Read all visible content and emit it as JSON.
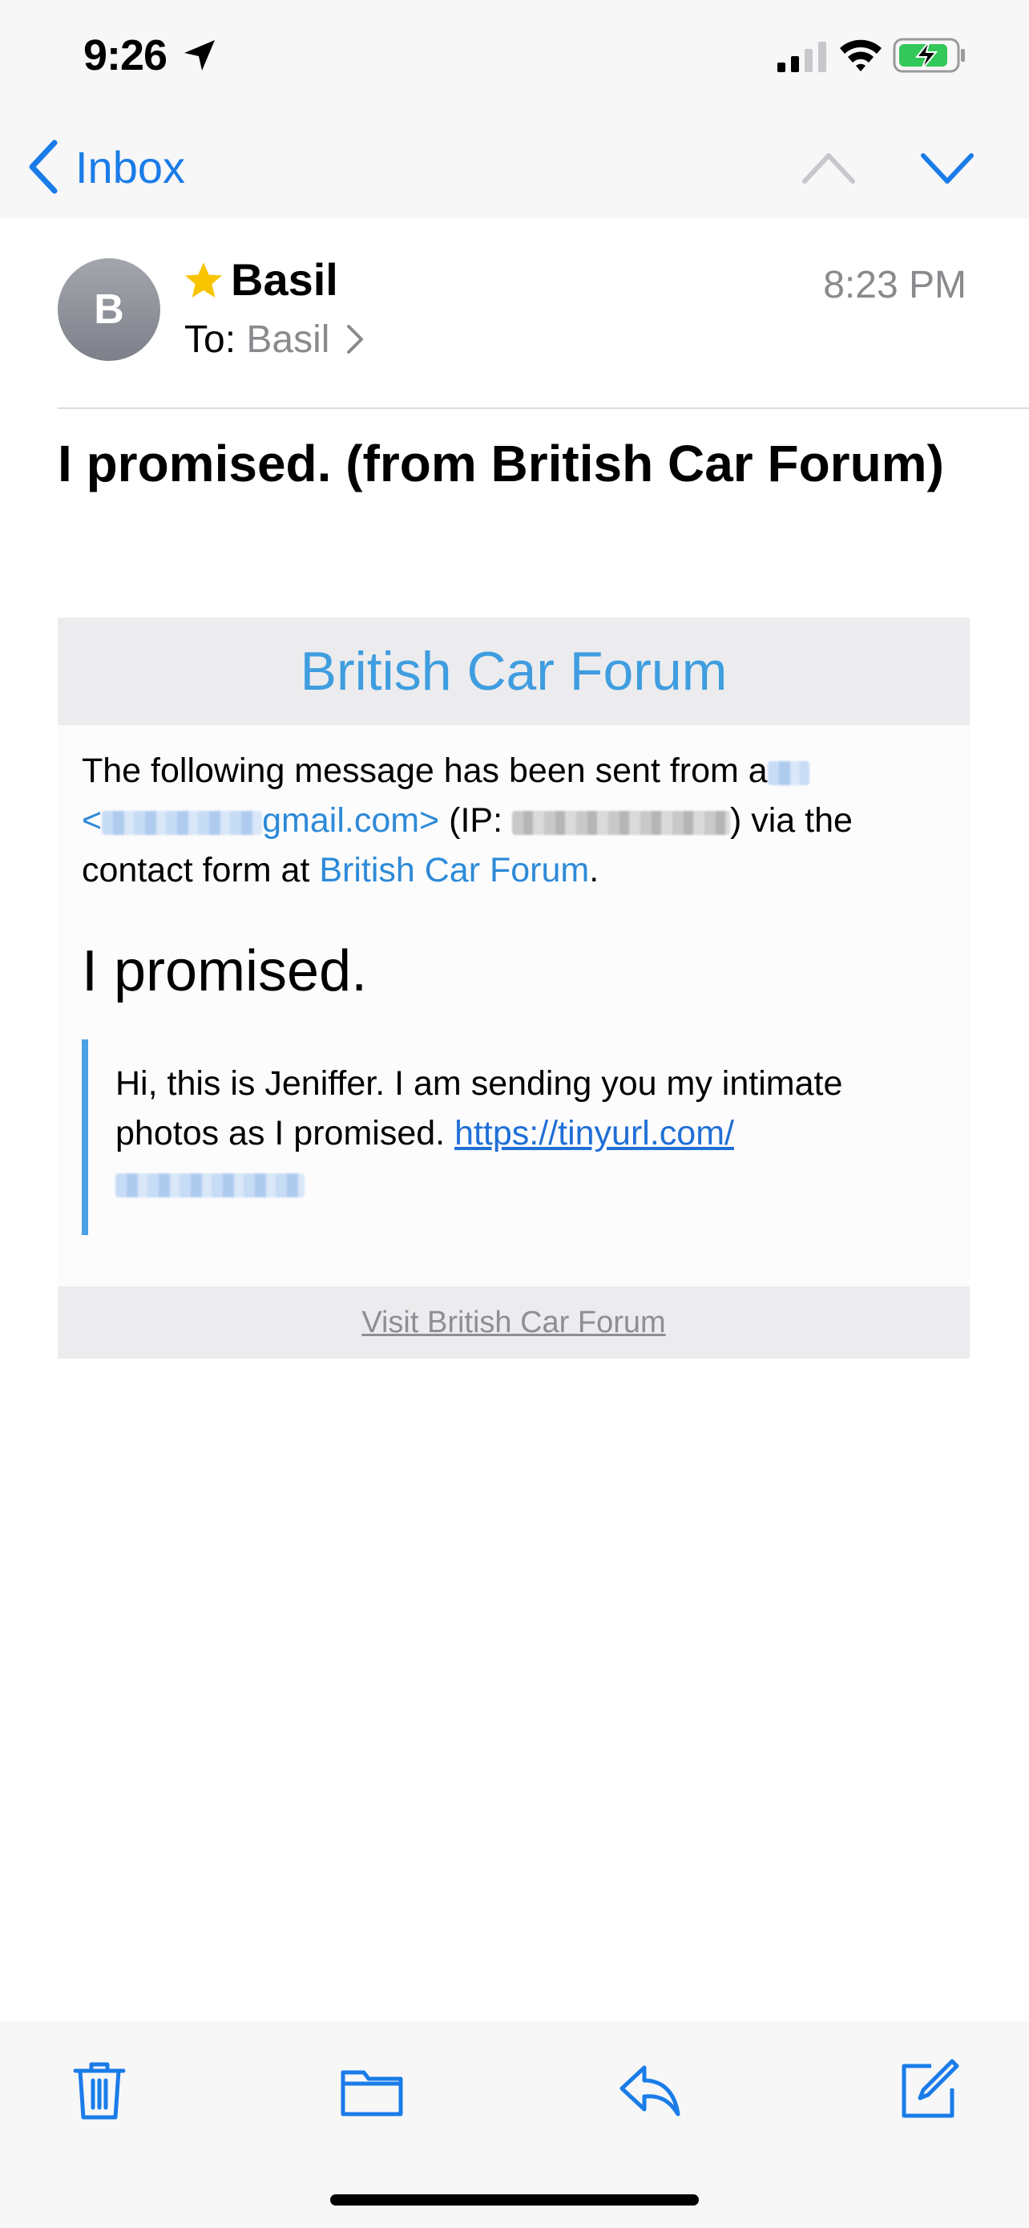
{
  "status_bar": {
    "time": "9:26",
    "location_icon": "location-arrow-icon",
    "signal_icon": "cellular-signal-icon",
    "wifi_icon": "wifi-icon",
    "battery_icon": "battery-charging-icon",
    "battery_color": "#34c759"
  },
  "nav": {
    "back_label": "Inbox",
    "prev_icon": "chevron-up-icon",
    "next_icon": "chevron-down-icon",
    "accent": "#1a7ce8"
  },
  "email": {
    "sender_initial": "B",
    "sender_name": "Basil",
    "to_label": "To:",
    "recipient": "Basil",
    "time": "8:23 PM",
    "subject": "I promised. (from British Car Forum)"
  },
  "card": {
    "header_title": "British Car Forum",
    "intro_part1": "The following message has been sent from a",
    "email_lt": "<",
    "email_domain": "gmail.com>",
    "ip_label": " (IP: ",
    "via_text": ") via the contact form at ",
    "forum_link": "British Car Forum",
    "period": ".",
    "message_heading": "I promised.",
    "message_body": "Hi, this is Jeniffer. I am sending you my intimate photos as I promised.",
    "message_url": "https://tinyurl.com/",
    "footer_link": "Visit British Car Forum"
  },
  "toolbar": {
    "trash": "trash-icon",
    "folder": "folder-icon",
    "reply": "reply-icon",
    "compose": "compose-icon"
  }
}
